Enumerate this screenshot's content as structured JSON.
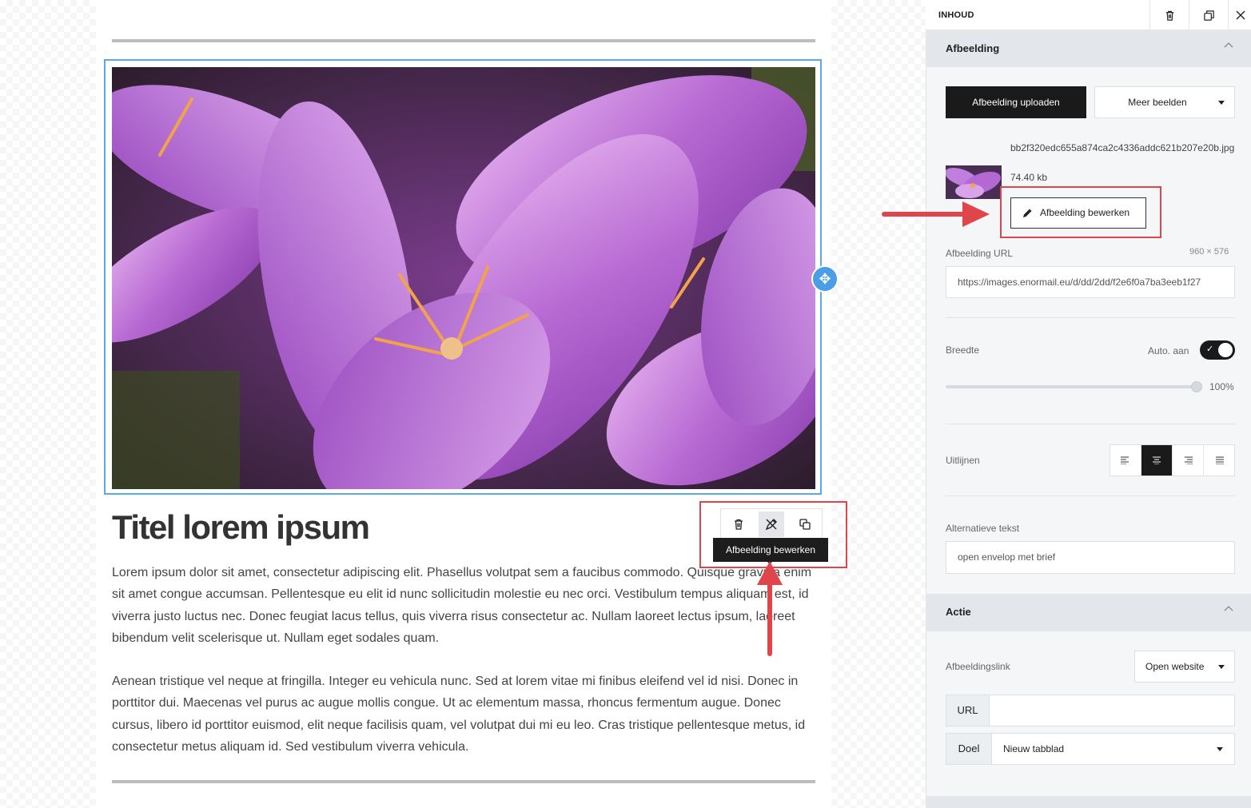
{
  "canvas": {
    "title": "Titel lorem ipsum",
    "paragraph1": "Lorem ipsum dolor sit amet, consectetur adipiscing elit. Phasellus volutpat sem a faucibus commodo. Quisque gravida enim sit amet congue accumsan. Pellentesque eu elit id nunc sollicitudin molestie eu nec orci. Vestibulum tempus aliquam est, id viverra justo luctus nec. Donec feugiat lacus tellus, quis viverra risus consectetur ac. Nullam laoreet lectus ipsum, laoreet bibendum velit scelerisque ut. Nullam eget sodales quam.",
    "paragraph2": "Aenean tristique vel neque at fringilla. Integer eu vehicula nunc. Sed at lorem vitae mi finibus eleifend vel id nisi. Donec in porttitor dui. Maecenas vel purus ac augue mollis congue. Ut ac elementum massa, rhoncus fermentum augue. Donec cursus, libero id porttitor euismod, elit neque facilisis quam, vel volutpat dui mi eu leo. Cras tristique pellentesque metus, id consectetur metus aliquam id. Sed vestibulum viverra vehicula.",
    "tooltip": "Afbeelding bewerken"
  },
  "panel": {
    "tab_label": "INHOUD",
    "section_image": "Afbeelding",
    "upload_button": "Afbeelding uploaden",
    "more_images": "Meer beelden",
    "file_name": "bb2f320edc655a874ca2c4336addc621b207e20b.jpg",
    "file_size": "74.40 kb",
    "edit_button": "Afbeelding bewerken",
    "image_url_label": "Afbeelding URL",
    "image_dimensions": "960 × 576",
    "image_url_value": "https://images.enormail.eu/d/dd/2dd/f2e6f0a7ba3eeb1f27",
    "width_label": "Breedte",
    "auto_label": "Auto. aan",
    "width_percent": "100%",
    "align_label": "Uitlijnen",
    "alt_label": "Alternatieve tekst",
    "alt_value": "open envelop met brief",
    "section_action": "Actie",
    "link_label": "Afbeeldingslink",
    "link_select": "Open website",
    "url_addon": "URL",
    "url_value": "",
    "target_addon": "Doel",
    "target_select": "Nieuw tabblad"
  },
  "state": {
    "auto_width_on": true,
    "width_value": 1.0,
    "alignment": "center"
  },
  "colors": {
    "accent_blue": "#5aa9e6",
    "highlight_red": "#e0454b",
    "dark": "#1a1a1a"
  }
}
